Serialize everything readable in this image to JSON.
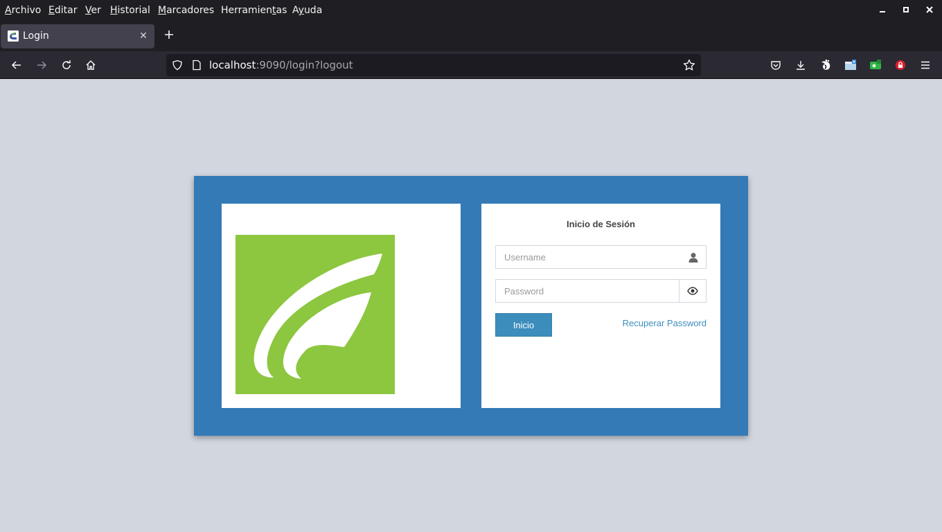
{
  "menubar": {
    "items": [
      {
        "prefix": "",
        "ul": "A",
        "rest": "rchivo"
      },
      {
        "prefix": "",
        "ul": "E",
        "rest": "ditar"
      },
      {
        "prefix": "",
        "ul": "V",
        "rest": "er"
      },
      {
        "prefix": "",
        "ul": "H",
        "rest": "istorial"
      },
      {
        "prefix": "",
        "ul": "M",
        "rest": "arcadores"
      },
      {
        "prefix": "Herramien",
        "ul": "t",
        "rest": "as"
      },
      {
        "prefix": "A",
        "ul": "y",
        "rest": "uda"
      }
    ]
  },
  "tabs": [
    {
      "title": "Login",
      "close": "✕",
      "favicon": "app-favicon"
    }
  ],
  "navbar": {
    "url_host": "localhost",
    "url_rest": ":9090/login?logout"
  },
  "icons": {
    "back": "arrow-left-icon",
    "forward": "arrow-right-icon",
    "reload": "reload-icon",
    "home": "home-icon",
    "shield": "shield-icon",
    "page": "page-icon",
    "bookmark": "star-icon",
    "pocket": "pocket-icon",
    "downloads": "download-icon",
    "menu": "hamburger-icon"
  },
  "login": {
    "title": "Inicio de Sesión",
    "username_placeholder": "Username",
    "password_placeholder": "Password",
    "submit_label": "Inicio",
    "recover_label": "Recuperar Password"
  },
  "colors": {
    "frame": "#337ab7",
    "logo_bg": "#8dc63f",
    "button": "#3c8dbc",
    "page_bg": "#d2d6df"
  }
}
